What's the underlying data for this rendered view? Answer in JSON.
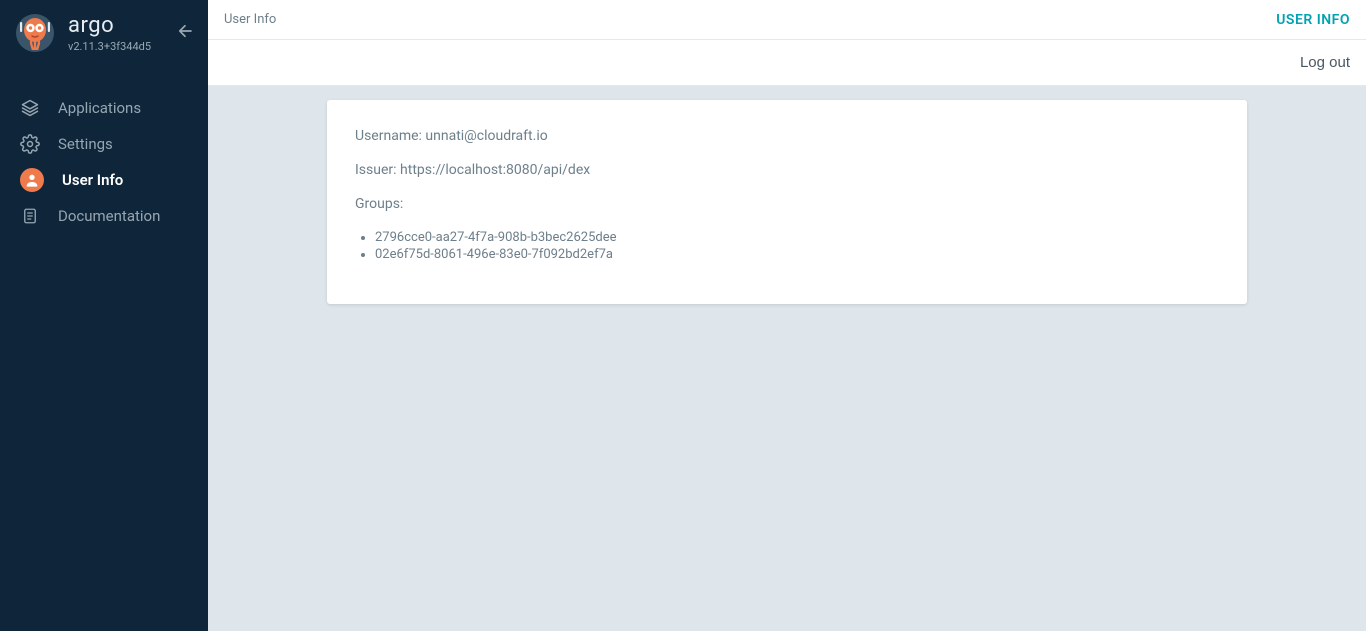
{
  "sidebar": {
    "product": "argo",
    "version": "v2.11.3+3f344d5",
    "items": [
      {
        "label": "Applications",
        "icon": "layers"
      },
      {
        "label": "Settings",
        "icon": "gear"
      },
      {
        "label": "User Info",
        "icon": "user-circle"
      },
      {
        "label": "Documentation",
        "icon": "book"
      }
    ],
    "active_index": 2
  },
  "header": {
    "breadcrumb": "User Info",
    "title": "USER INFO",
    "logout": "Log out"
  },
  "user_info": {
    "username_label": "Username:",
    "username_value": "unnati@cloudraft.io",
    "issuer_label": "Issuer:",
    "issuer_value": "https://localhost:8080/api/dex",
    "groups_label": "Groups:",
    "groups": [
      "2796cce0-aa27-4f7a-908b-b3bec2625dee",
      "02e6f75d-8061-496e-83e0-7f092bd2ef7a"
    ]
  }
}
